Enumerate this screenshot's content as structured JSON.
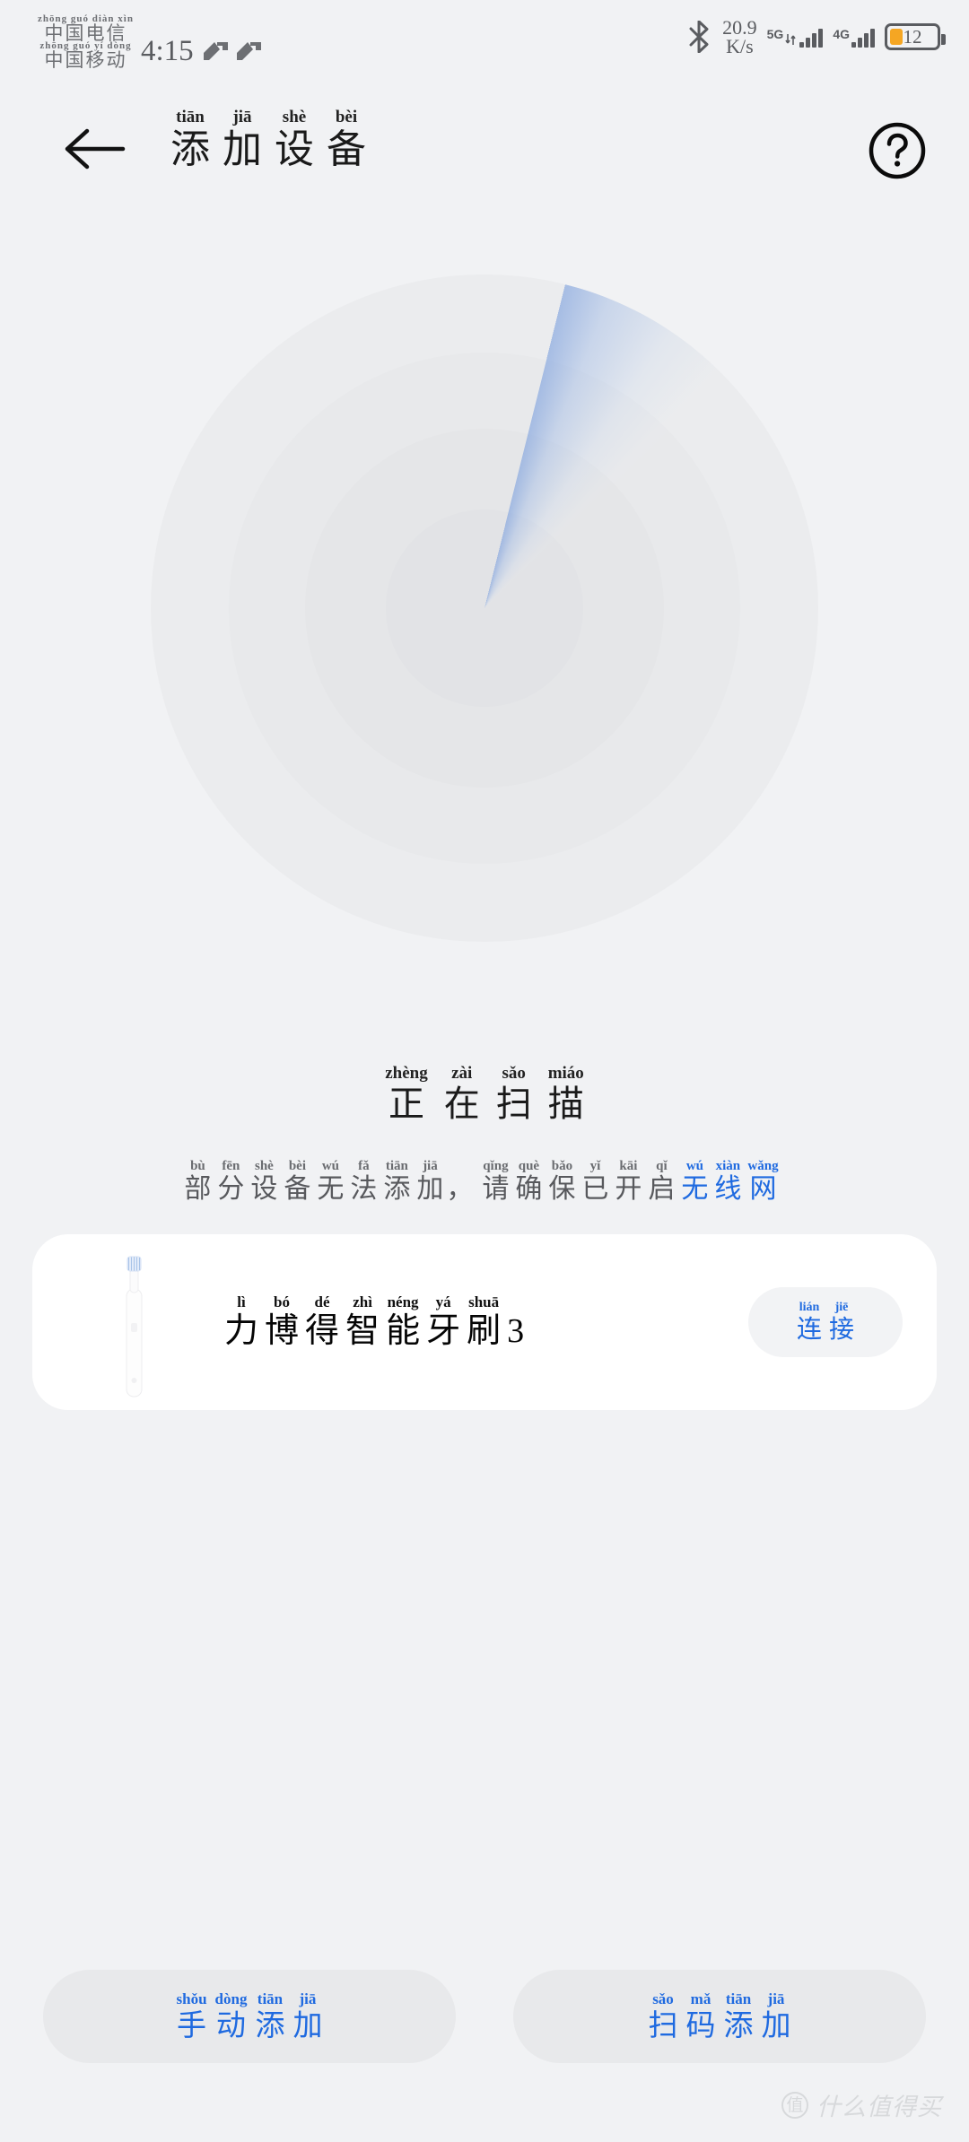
{
  "status_bar": {
    "carriers": [
      {
        "pinyin": "zhōng guó diàn xìn",
        "text": "中国电信"
      },
      {
        "pinyin": "zhōng guó yí dòng",
        "text": "中国移动"
      }
    ],
    "time": "4:15",
    "vpn_icon": "vpn-key-icon",
    "bluetooth_icon": "bluetooth-icon",
    "network_speed_value": "20.9",
    "network_speed_unit": "K/s",
    "sim1_network": "5G",
    "sim2_network": "4G",
    "battery_percent": "12",
    "battery_color": "#f5a623"
  },
  "app_bar": {
    "back_icon": "back-arrow-icon",
    "help_icon": "question-mark-icon",
    "title": [
      {
        "pinyin": "tiān",
        "char": "添"
      },
      {
        "pinyin": "jiā",
        "char": "加"
      },
      {
        "pinyin": "shè",
        "char": "设"
      },
      {
        "pinyin": "bèi",
        "char": "备"
      }
    ],
    "title_text": "添加设备"
  },
  "radar": {
    "icon": "radar-scan-animation",
    "sweep_color": "#7ca0de",
    "ring_colors": [
      "#ebecee",
      "#e8e9eb",
      "#e5e6e8",
      "#e2e3e6"
    ]
  },
  "scanning": {
    "label": [
      {
        "pinyin": "zhèng",
        "char": "正"
      },
      {
        "pinyin": "zài",
        "char": "在"
      },
      {
        "pinyin": "sǎo",
        "char": "扫"
      },
      {
        "pinyin": "miáo",
        "char": "描"
      }
    ],
    "label_text": "正在扫描"
  },
  "hint": {
    "segments": [
      {
        "pinyin": "bù",
        "char": "部",
        "accent": false
      },
      {
        "pinyin": "fēn",
        "char": "分",
        "accent": false
      },
      {
        "pinyin": "shè",
        "char": "设",
        "accent": false
      },
      {
        "pinyin": "bèi",
        "char": "备",
        "accent": false
      },
      {
        "pinyin": "wú",
        "char": "无",
        "accent": false
      },
      {
        "pinyin": "fǎ",
        "char": "法",
        "accent": false
      },
      {
        "pinyin": "tiān",
        "char": "添",
        "accent": false
      },
      {
        "pinyin": "jiā",
        "char": "加",
        "accent": false
      },
      {
        "pinyin": "",
        "char": "，",
        "accent": false
      },
      {
        "pinyin": "qǐng",
        "char": "请",
        "accent": false
      },
      {
        "pinyin": "què",
        "char": "确",
        "accent": false
      },
      {
        "pinyin": "bǎo",
        "char": "保",
        "accent": false
      },
      {
        "pinyin": "yǐ",
        "char": "已",
        "accent": false
      },
      {
        "pinyin": "kāi",
        "char": "开",
        "accent": false
      },
      {
        "pinyin": "qǐ",
        "char": "启",
        "accent": false
      },
      {
        "pinyin": "wú",
        "char": "无",
        "accent": true
      },
      {
        "pinyin": "xiàn",
        "char": "线",
        "accent": true
      },
      {
        "pinyin": "wǎng",
        "char": "网",
        "accent": true
      }
    ],
    "full_text": "部分设备无法添加，请确保已开启无线网",
    "accent_color": "#1f6ae0"
  },
  "device_card": {
    "thumb_icon": "electric-toothbrush-icon",
    "name_segments": [
      {
        "pinyin": "lì",
        "char": "力"
      },
      {
        "pinyin": "bó",
        "char": "博"
      },
      {
        "pinyin": "dé",
        "char": "得"
      },
      {
        "pinyin": "zhì",
        "char": "智"
      },
      {
        "pinyin": "néng",
        "char": "能"
      },
      {
        "pinyin": "yá",
        "char": "牙"
      },
      {
        "pinyin": "shuā",
        "char": "刷"
      }
    ],
    "name_suffix": "3",
    "name_text": "力博得智能牙刷3",
    "connect": [
      {
        "pinyin": "lián",
        "char": "连"
      },
      {
        "pinyin": "jiē",
        "char": "接"
      }
    ],
    "connect_text": "连接"
  },
  "bottom_buttons": [
    {
      "name": "manual-add",
      "segments": [
        {
          "pinyin": "shǒu",
          "char": "手"
        },
        {
          "pinyin": "dòng",
          "char": "动"
        },
        {
          "pinyin": "tiān",
          "char": "添"
        },
        {
          "pinyin": "jiā",
          "char": "加"
        }
      ],
      "text": "手动添加"
    },
    {
      "name": "scan-code-add",
      "segments": [
        {
          "pinyin": "sǎo",
          "char": "扫"
        },
        {
          "pinyin": "mǎ",
          "char": "码"
        },
        {
          "pinyin": "tiān",
          "char": "添"
        },
        {
          "pinyin": "jiā",
          "char": "加"
        }
      ],
      "text": "扫码添加"
    }
  ],
  "watermark": {
    "badge": "值",
    "text": "什么值得买"
  }
}
